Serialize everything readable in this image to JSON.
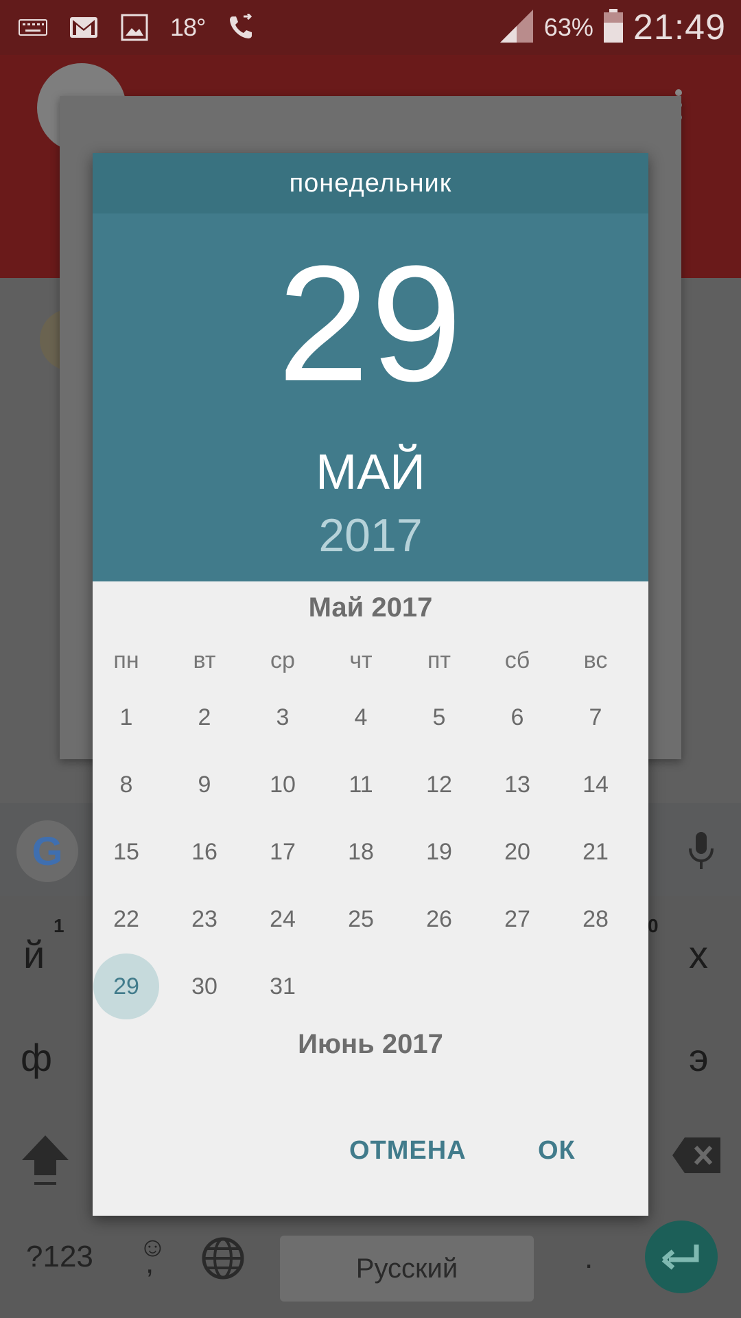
{
  "statusbar": {
    "temperature": "18°",
    "battery_percent": "63%",
    "time": "21:49",
    "icons": [
      "keyboard-icon",
      "gmail-icon",
      "gallery-icon",
      "call-forward-icon",
      "signal-icon",
      "battery-icon"
    ]
  },
  "keyboard": {
    "top_row_first": "й",
    "top_row_hint_first": "1",
    "top_row_last": "х",
    "top_row_hint_last": "0",
    "middle_row_first": "ф",
    "middle_row_last": "э",
    "symbols_label": "?123",
    "emoji_label": "☺",
    "comma_label": ",",
    "space_label": "Русский",
    "period_label": "."
  },
  "picker": {
    "weekday": "понедельник",
    "day": "29",
    "month": "МАЙ",
    "year": "2017",
    "calendar_title": "Май 2017",
    "next_month_title": "Июнь 2017",
    "weekdays": [
      "пн",
      "вт",
      "ср",
      "чт",
      "пт",
      "сб",
      "вс"
    ],
    "days": [
      "1",
      "2",
      "3",
      "4",
      "5",
      "6",
      "7",
      "8",
      "9",
      "10",
      "11",
      "12",
      "13",
      "14",
      "15",
      "16",
      "17",
      "18",
      "19",
      "20",
      "21",
      "22",
      "23",
      "24",
      "25",
      "26",
      "27",
      "28",
      "29",
      "30",
      "31"
    ],
    "selected_day": "29",
    "cancel_label": "ОТМЕНА",
    "ok_label": "ОК"
  },
  "colors": {
    "header": "#417b8b",
    "weekday_bar": "#397280",
    "selected_circle": "#c6dadc",
    "button_text": "#417b8b"
  }
}
